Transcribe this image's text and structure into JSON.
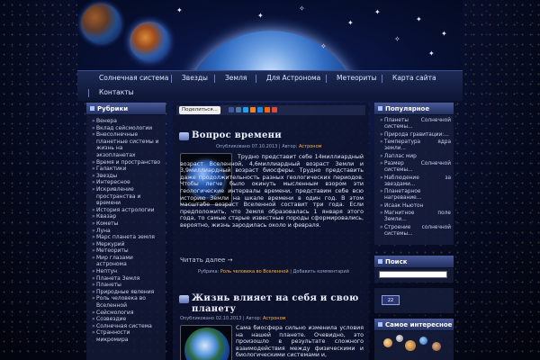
{
  "nav": {
    "items": [
      "Солнечная система",
      "Звезды",
      "Земля",
      "Для Астронома",
      "Метеориты",
      "Карта сайта",
      "Контакты"
    ]
  },
  "sidebar_left": {
    "title": "Рубрики",
    "categories": [
      "Венера",
      "Вклад сейсмологии",
      "Внесолнечные планетные системы и жизнь на экзопланетах",
      "Время и пространство",
      "Галактики",
      "Звезды",
      "Интересное",
      "Искривление пространства и времени",
      "История астрологии",
      "Квазар",
      "Кометы",
      "Луна",
      "Марс планета земля",
      "Меркурий",
      "Метеориты",
      "Мир глазами астронома",
      "Нептун",
      "Планета Земля",
      "Планеты",
      "Природные явления",
      "Роль человека во Вселенной",
      "Сейсмология",
      "Созвездие",
      "Солнечная система",
      "Странности микромира"
    ]
  },
  "share": {
    "label": "Поделиться..."
  },
  "posts": [
    {
      "title": "Вопрос времени",
      "meta_prefix": "Опубликовано 07.10.2013 | Автор: ",
      "author": "Астроном",
      "text": "Трудно представит себе 14миллиардный возраст Вселенной, 4,6миллиардный возраст Земли и 3,9миллиардный возраст биосферы. Трудно представить даже продолжительность разных геологических периодов. Чтобы легче было окинуть мысленным взором эти геологические интервалы времени, представим себе всю историю Земли на шкале времени в один год. В этом масштабе возраст Вселенной составит три года. Если предположить, что Земля образовалась 1 января этого года, то самые старые известные породы сформировались, вероятно, жизнь зародилась около и февраля.",
      "read_more": "Читать далее →",
      "rubric_prefix": "Рубрика: ",
      "rubric": "Роль человека во Вселенной",
      "comments": "Добавить комментарий"
    },
    {
      "title": "Жизнь влияет на себя и свою планету",
      "meta_prefix": "Опубликовано 02.10.2013 | Автор: ",
      "author": "Астроном",
      "text": "Сама биосфера сильно изменила условия на нашей планете. Очевидно, это произошло в результате сложного взаимодействия между физическими и биологическими системами и,"
    }
  ],
  "sidebar_right": {
    "popular_title": "Популярное",
    "popular": [
      "Планеты Солнечной системы...",
      "Природа гравитации:...",
      "Температура ядра земли...",
      "Лаплас мир",
      "Размер Солнечной системы...",
      "Наблюдение за звездами...",
      "Планетарное нагревание...",
      "Исаак Ньютон",
      "Магнитное поле Земли...",
      "Строение солнечной системы..."
    ],
    "search_title": "Поиск",
    "counter_value": "22",
    "interesting_title": "Самое интересное"
  },
  "colors": {
    "accent": "#ffb347",
    "title_bar": "#4a5a9a"
  }
}
